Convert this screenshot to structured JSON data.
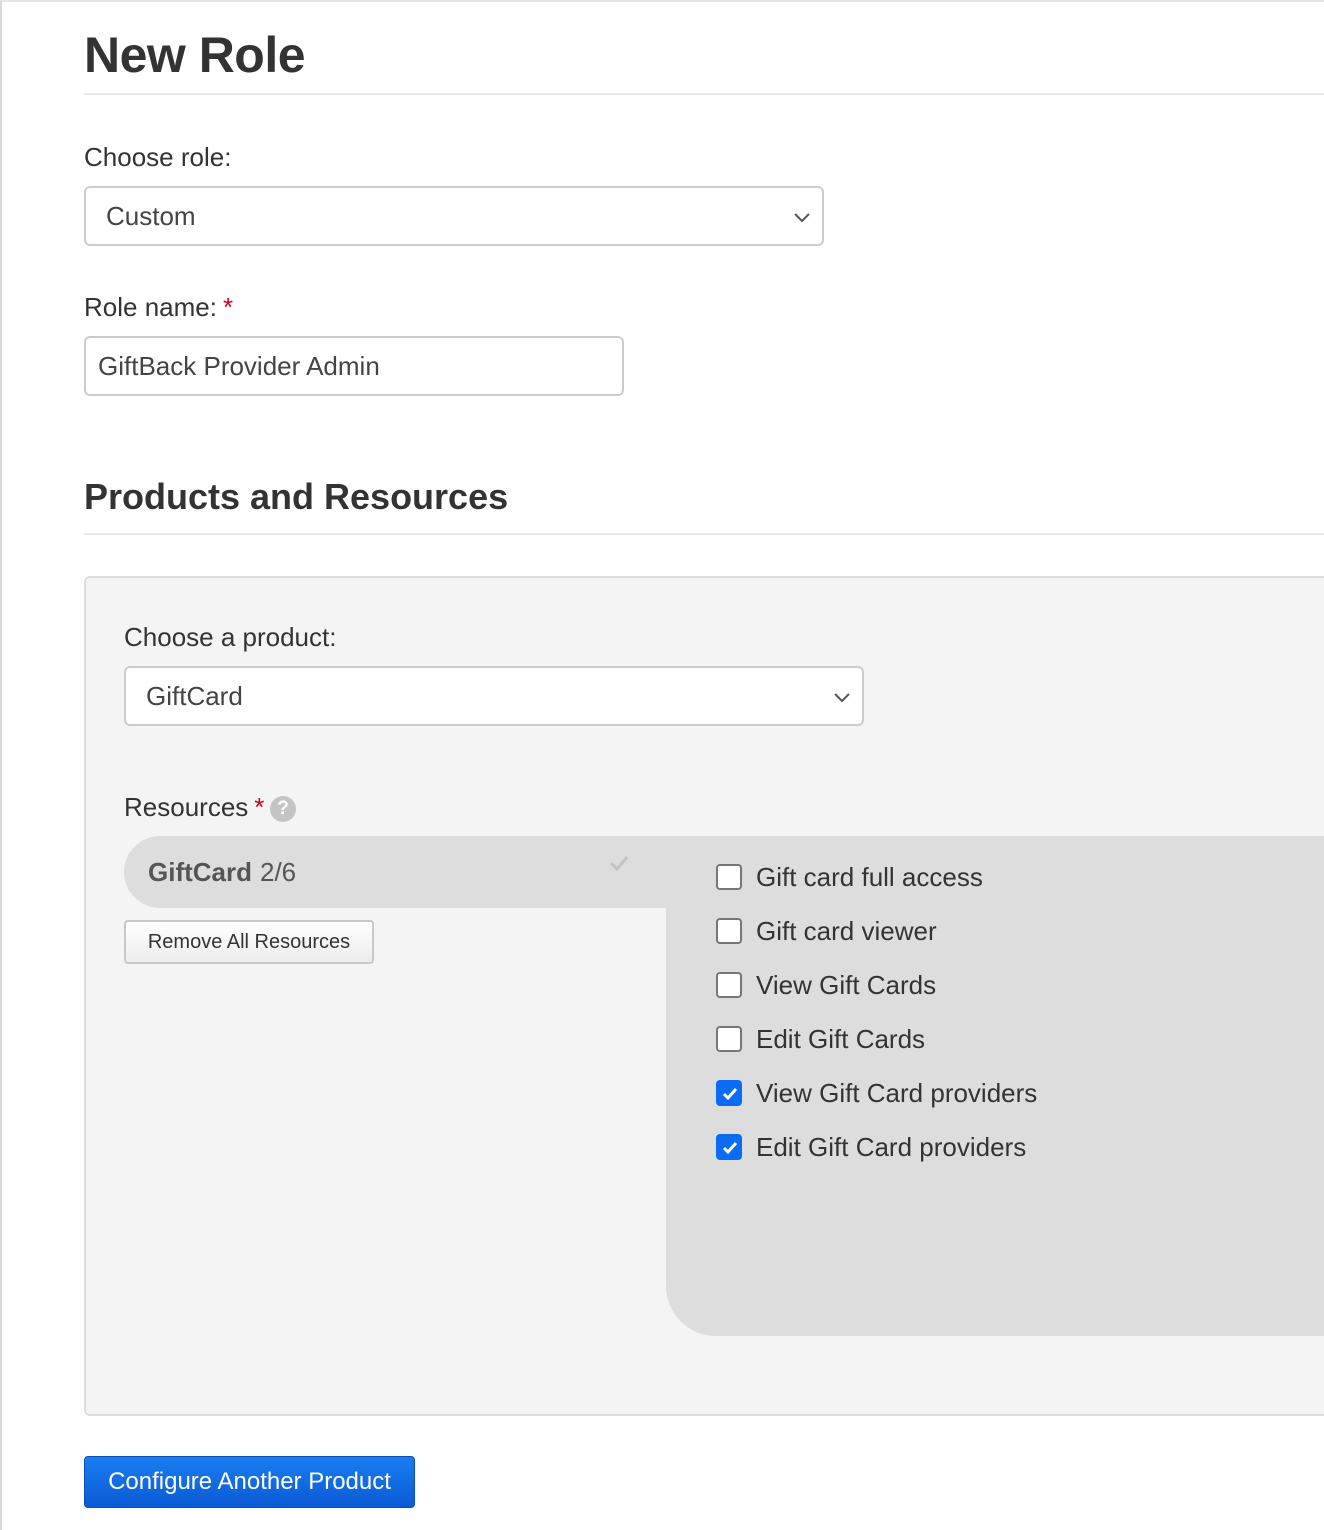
{
  "page": {
    "title": "New Role"
  },
  "role_select": {
    "label": "Choose role:",
    "value": "Custom"
  },
  "role_name": {
    "label": "Role name:",
    "required_mark": "*",
    "value": "GiftBack Provider Admin"
  },
  "products_section": {
    "title": "Products and Resources"
  },
  "product_select": {
    "label": "Choose a product:",
    "value": "GiftCard"
  },
  "resources": {
    "label": "Resources",
    "required_mark": "*",
    "help_icon": "?",
    "tab": {
      "name": "GiftCard",
      "count": "2/6"
    },
    "remove_all_label": "Remove All Resources",
    "items": [
      {
        "label": "Gift card full access",
        "checked": false
      },
      {
        "label": "Gift card viewer",
        "checked": false
      },
      {
        "label": "View Gift Cards",
        "checked": false
      },
      {
        "label": "Edit Gift Cards",
        "checked": false
      },
      {
        "label": "View Gift Card providers",
        "checked": true
      },
      {
        "label": "Edit Gift Card providers",
        "checked": true
      }
    ]
  },
  "configure_another_label": "Configure Another Product",
  "colors": {
    "accent": "#0a6cf5",
    "required": "#d0021b"
  }
}
